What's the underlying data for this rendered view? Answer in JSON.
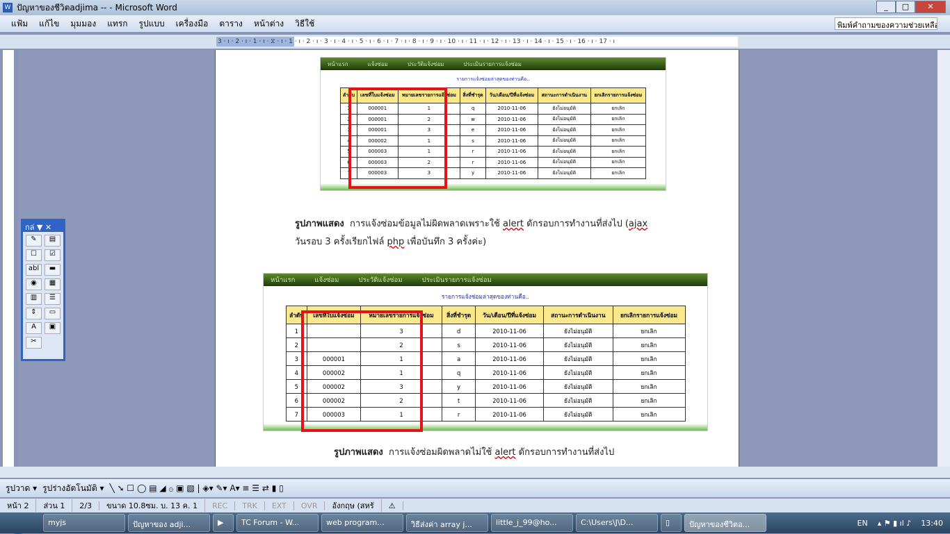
{
  "window": {
    "title": "ปัญหาของชีวิตadjima -- - Microsoft Word",
    "min": "_",
    "max": "□",
    "close": "✕"
  },
  "menu": [
    "แฟ้ม",
    "แก้ไข",
    "มุมมอง",
    "แทรก",
    "รูปแบบ",
    "เครื่องมือ",
    "ตาราง",
    "หน้าต่าง",
    "วิธีใช้"
  ],
  "help_placeholder": "พิมพ์คำถามของความช่วยเหลือ",
  "ruler": "3 · ı · 2 · ı · 1 · ı · ⧖ · ı · 1 · ı · 2 · ı · 3 · ı · 4 · ı · 5 · ı · 6 · ı · 7 · ı · 8 · ı · 9 · ı · 10 · ı · 11 · ı · 12 · ı · 13 · ı · 14 · ı · 15 · ı · 16 · ı · 17 · ı",
  "toolbox": {
    "title": "กล่ ▼ ✕",
    "tools": [
      "✎",
      "▤",
      "☐",
      "☑",
      "abl",
      "▬",
      "◉",
      "▦",
      "▥",
      "☰",
      "⇕",
      "▭",
      "A",
      "▣",
      "✂"
    ]
  },
  "screens": {
    "nav": [
      "หน้าแรก",
      "แจ้งซ่อม",
      "ประวัติแจ้งซ่อม",
      "ประเมินรายการแจ้งซ่อม"
    ],
    "subtitle": "รายการแจ้งซ่อมล่าสุดของท่านคือ..",
    "headers": [
      "ลำดับ",
      "เลขที่ใบแจ้งซ่อม",
      "หมายเลขรายการแจ้งซ่อม",
      "สิ่งที่ชำรุด",
      "วัน/เดือน/ปีที่แจ้งซ่อม",
      "สถานะการดำเนินงาน",
      "ยกเลิกรายการแจ้งซ่อม"
    ],
    "top_rows": [
      [
        "1",
        "000001",
        "1",
        "q",
        "2010-11-06",
        "ยังไม่อนุมัติ",
        "ยกเลิก"
      ],
      [
        "2",
        "000001",
        "2",
        "w",
        "2010-11-06",
        "ยังไม่อนุมัติ",
        "ยกเลิก"
      ],
      [
        "3",
        "000001",
        "3",
        "e",
        "2010-11-06",
        "ยังไม่อนุมัติ",
        "ยกเลิก"
      ],
      [
        "4",
        "000002",
        "1",
        "s",
        "2010-11-06",
        "ยังไม่อนุมัติ",
        "ยกเลิก"
      ],
      [
        "5",
        "000003",
        "1",
        "r",
        "2010-11-06",
        "ยังไม่อนุมัติ",
        "ยกเลิก"
      ],
      [
        "6",
        "000003",
        "2",
        "r",
        "2010-11-06",
        "ยังไม่อนุมัติ",
        "ยกเลิก"
      ],
      [
        "7",
        "000003",
        "3",
        "y",
        "2010-11-06",
        "ยังไม่อนุมัติ",
        "ยกเลิก"
      ]
    ],
    "bottom_rows": [
      [
        "1",
        "",
        "3",
        "d",
        "2010-11-06",
        "ยังไม่อนุมัติ",
        "ยกเลิก"
      ],
      [
        "2",
        "",
        "2",
        "s",
        "2010-11-06",
        "ยังไม่อนุมัติ",
        "ยกเลิก"
      ],
      [
        "3",
        "000001",
        "1",
        "a",
        "2010-11-06",
        "ยังไม่อนุมัติ",
        "ยกเลิก"
      ],
      [
        "4",
        "000002",
        "1",
        "q",
        "2010-11-06",
        "ยังไม่อนุมัติ",
        "ยกเลิก"
      ],
      [
        "5",
        "000002",
        "3",
        "y",
        "2010-11-06",
        "ยังไม่อนุมัติ",
        "ยกเลิก"
      ],
      [
        "6",
        "000002",
        "2",
        "t",
        "2010-11-06",
        "ยังไม่อนุมัติ",
        "ยกเลิก"
      ],
      [
        "7",
        "000003",
        "1",
        "r",
        "2010-11-06",
        "ยังไม่อนุมัติ",
        "ยกเลิก"
      ]
    ]
  },
  "caption1": {
    "label": "รูปภาพแสดง",
    "line1a": "การแจ้งซ่อมข้อมูลไม่ผิดพลาดเพราะใช้ ",
    "alert": "alert",
    "line1b": " ดักรอบการทำงานที่ส่งไป (",
    "ajax": "ajax",
    "line2a": "วันรอบ 3 ครั้งเรียกไฟล์ ",
    "php": "php",
    "line2b": " เพื่อบันทึก 3 ครั้งค่ะ)"
  },
  "caption2": {
    "label": "รูปภาพแสดง",
    "a": "การแจ้งซ่อมผิดพลาดไม่ใช้ ",
    "alert": "alert",
    "b": " ดักรอบการทำงานที่ส่งไป"
  },
  "drawbar": {
    "draw": "รูปวาด ▾",
    "autoshapes": "รูปร่างอัตโนมัติ ▾",
    "tools": "╲ ➘ ☐ ◯ ▤ ◢ ۞ ▣ ▧ | ◈▾ ✎▾ A▾ ≡ ☰ ⇄ ▮ ▯"
  },
  "status": [
    "หน้า 2",
    "ส่วน 1",
    "2/3",
    "ขนาด 10.8ซม.  บ. 13   ค. 1",
    "REC",
    "TRK",
    "EXT",
    "OVR",
    "อังกฤษ (สหรั",
    "⚠"
  ],
  "taskbar": [
    "myjs",
    "ปัญหาของ adji...",
    "▶",
    "TC Forum - W...",
    "web program...",
    "วิธีส่งค่า array j...",
    "little_j_99@ho...",
    "C:\\Users\\J\\D...",
    "▯",
    "ปัญหาของชีวิตอ..."
  ],
  "tray": {
    "lang": "EN",
    "time": "13:40"
  }
}
